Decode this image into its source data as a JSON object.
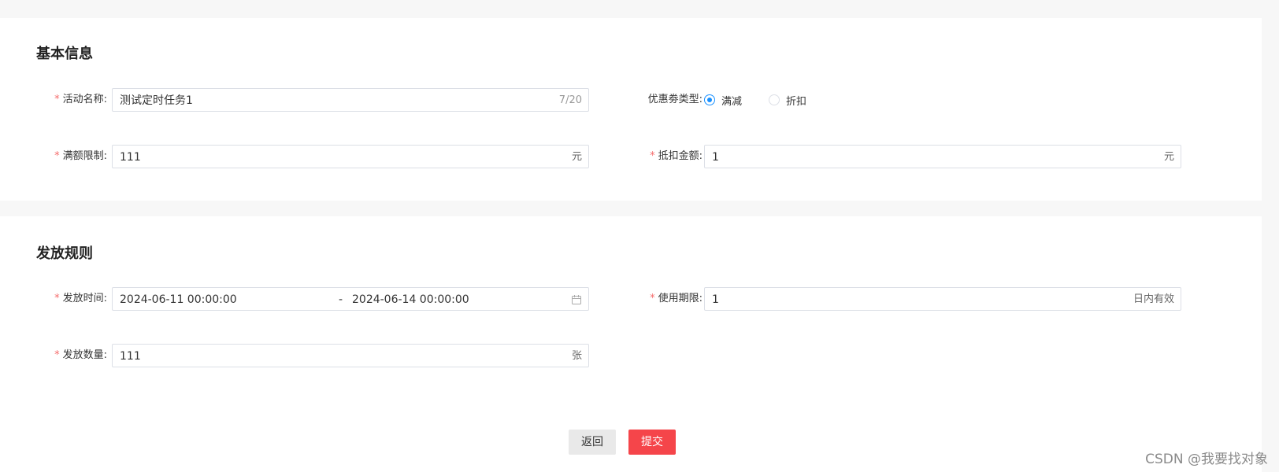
{
  "sections": {
    "basic": {
      "title": "基本信息",
      "activity_name": {
        "label": "活动名称:",
        "value": "测试定时任务1",
        "counter": "7/20"
      },
      "coupon_type": {
        "label": "优惠劵类型:",
        "options": [
          {
            "label": "满减",
            "checked": true
          },
          {
            "label": "折扣",
            "checked": false
          }
        ]
      },
      "threshold": {
        "label": "满额限制:",
        "value": "111",
        "unit": "元"
      },
      "discount_amount": {
        "label": "抵扣金额:",
        "value": "1",
        "unit": "元"
      }
    },
    "rules": {
      "title": "发放规则",
      "issue_time": {
        "label": "发放时间:",
        "start": "2024-06-11 00:00:00",
        "separator": "-",
        "end": "2024-06-14 00:00:00"
      },
      "validity": {
        "label": "使用期限:",
        "value": "1",
        "unit": "日内有效"
      },
      "quantity": {
        "label": "发放数量:",
        "value": "111",
        "unit": "张"
      }
    }
  },
  "actions": {
    "back_label": "返回",
    "submit_label": "提交"
  },
  "watermark": "CSDN @我要找对象",
  "colors": {
    "accent": "#1890ff",
    "required": "#f56c6c",
    "submit": "#f5454a"
  }
}
